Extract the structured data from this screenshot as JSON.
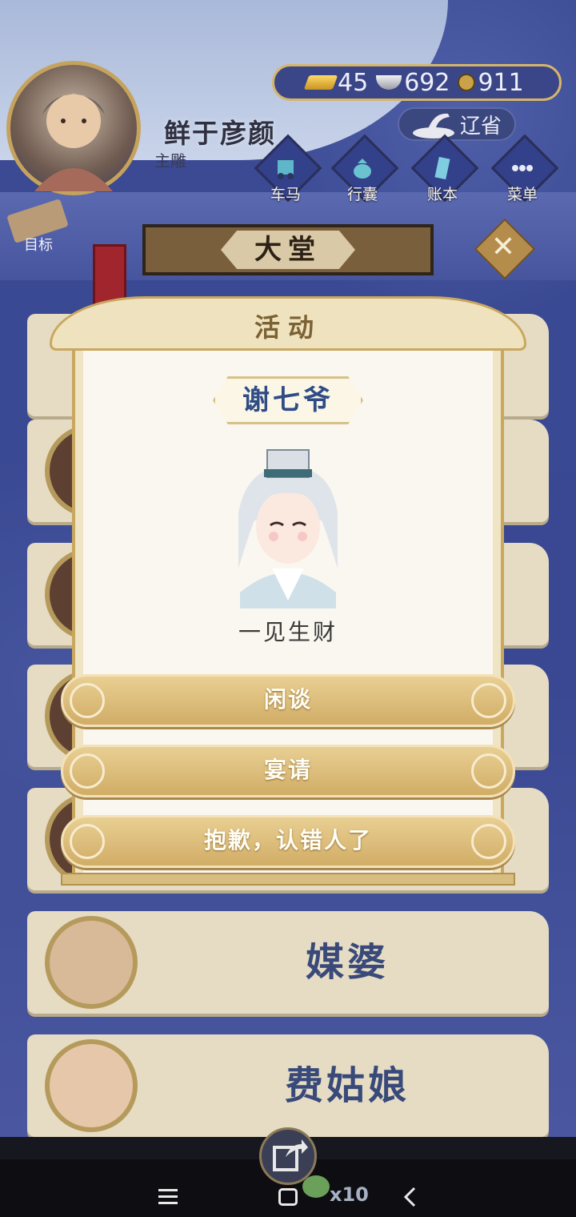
{
  "player": {
    "name": "鲜于彦颜",
    "title": "主雕"
  },
  "currency": {
    "gold": "45",
    "silver": "692",
    "coins": "911"
  },
  "province": "辽省",
  "nav": [
    {
      "label": "车马",
      "icon": "carriage-icon"
    },
    {
      "label": "行囊",
      "icon": "bag-icon"
    },
    {
      "label": "账本",
      "icon": "ledger-icon"
    },
    {
      "label": "菜单",
      "icon": "menu-dots-icon"
    }
  ],
  "goal_label": "目标",
  "hall_title": "大堂",
  "cards": [
    {
      "name": "媒婆"
    },
    {
      "name": "费姑娘"
    }
  ],
  "modal": {
    "title": "活动",
    "npc_name": "谢七爷",
    "npc_desc": "一见生财",
    "options": [
      "闲谈",
      "宴请",
      "抱歉，认错人了"
    ]
  },
  "bottom": {
    "multiplier": "x10"
  },
  "colors": {
    "accent_gold": "#d1ad66",
    "name_blue": "#2f4c85",
    "panel_cream": "#faf7f0"
  }
}
